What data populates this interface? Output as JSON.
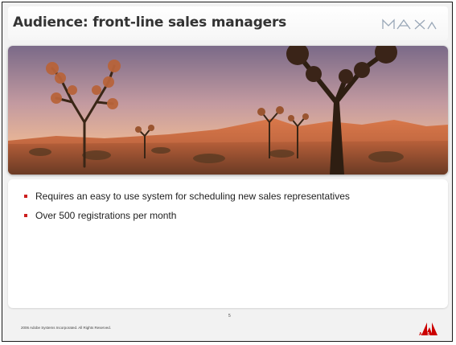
{
  "slide": {
    "title": "Audience: front-line sales managers",
    "logo_text": "MAX",
    "bullets": [
      "Requires an easy to use system for scheduling new sales representatives",
      "Over 500 registrations per month"
    ],
    "footer": "2006 Adobe Systems Incorporated.  All Rights Reserved.",
    "page_number": "5",
    "brand": "Adobe"
  },
  "colors": {
    "bullet": "#cc1f1f",
    "adobe_red": "#cc0000",
    "title": "#333333"
  },
  "icons": {
    "logo": "max-logo-icon",
    "brand": "adobe-logo-icon"
  }
}
